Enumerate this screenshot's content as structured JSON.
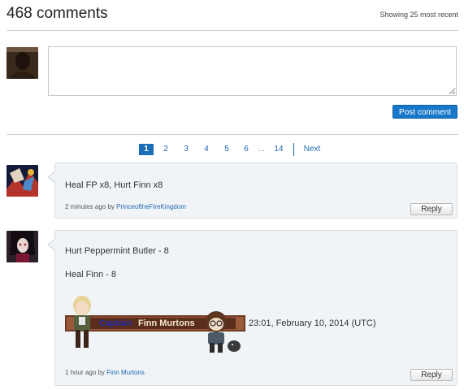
{
  "header": {
    "count_title": "468 comments",
    "showing": "Showing 25 most recent"
  },
  "compose": {
    "placeholder": "",
    "post_label": "Post comment"
  },
  "pagination": {
    "pages": [
      "1",
      "2",
      "3",
      "4",
      "5",
      "6"
    ],
    "ellipsis": "...",
    "last": "14",
    "next": "Next",
    "active": "1"
  },
  "comments": [
    {
      "text": "Heal FP x8, Hurt Finn x8",
      "time": "2 minutes ago by",
      "author": "PrinceoftheFireKingdom",
      "reply": "Reply"
    },
    {
      "line1": "Hurt Peppermint Butler - 8",
      "line2": "Heal Finn - 8",
      "sig_captain": "Captain",
      "sig_name": "Finn Murtons",
      "sig_time": "23:01, February 10, 2014 (UTC)",
      "time": "1 hour ago by",
      "author": "Finn Murtons",
      "reply": "Reply"
    }
  ]
}
